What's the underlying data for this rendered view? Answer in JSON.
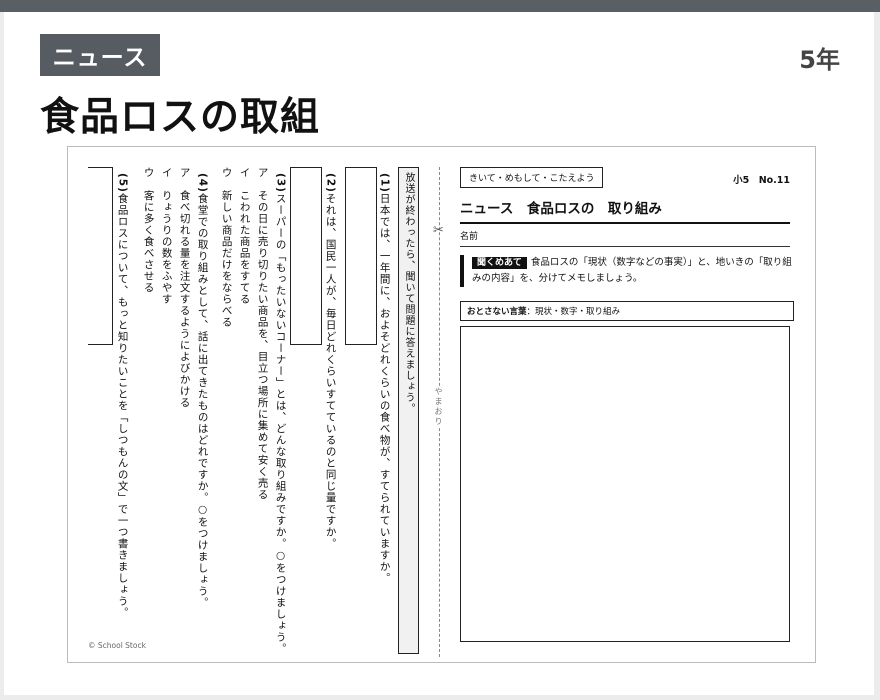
{
  "header": {
    "badge": "ニュース",
    "grade": "5年",
    "title": "食品ロスの取組"
  },
  "worksheet": {
    "instruction": "放送が終わったら、聞いて問題に答えましょう。",
    "q1": {
      "number": "(1)",
      "text": "日本では、一年間に、およそどれくらいの食べ物が、すてられていますか。"
    },
    "q2": {
      "number": "(2)",
      "text": "それは、国民一人が、毎日どれくらいすてているのと同じ量ですか。"
    },
    "q3": {
      "number": "(3)",
      "line1": "スーパーの「もったいないコーナー」とは、どんな取り組みですか。○をつけましょう。",
      "options": [
        "ア　その日に売り切りたい商品を、目立つ場所に集めて安く売る",
        "イ　こわれた商品をすてる",
        "ウ　新しい商品だけをならべる"
      ]
    },
    "q4": {
      "number": "(4)",
      "line1": "食堂での取り組みとして、話に出てきたものはどれですか。○をつけましょう。",
      "options": [
        "ア　食べ切れる量を注文するようによびかける",
        "イ　りょうりの数をふやす",
        "ウ　客に多く食べさせる"
      ]
    },
    "q5": {
      "number": "(5)",
      "text": "食品ロスについて、もっと知りたいことを「しつもんの文」で一つ書きましょう。"
    },
    "fold_label": "やまおり",
    "copyright": "© School Stock",
    "right": {
      "kiite": "きいて・めもして・こたえよう",
      "no": "小5　No.11",
      "title": "ニュース　食品ロスの　取り組み",
      "name_label": "名前",
      "kiku_label": "聞くめあて",
      "kiku_text": "食品ロスの「現状（数字などの事実）」と、地いきの「取り組みの内容」を、分けてメモしましょう。",
      "words_label": "おとさない言葉",
      "words_text": "：現状・数字・取り組み"
    }
  }
}
